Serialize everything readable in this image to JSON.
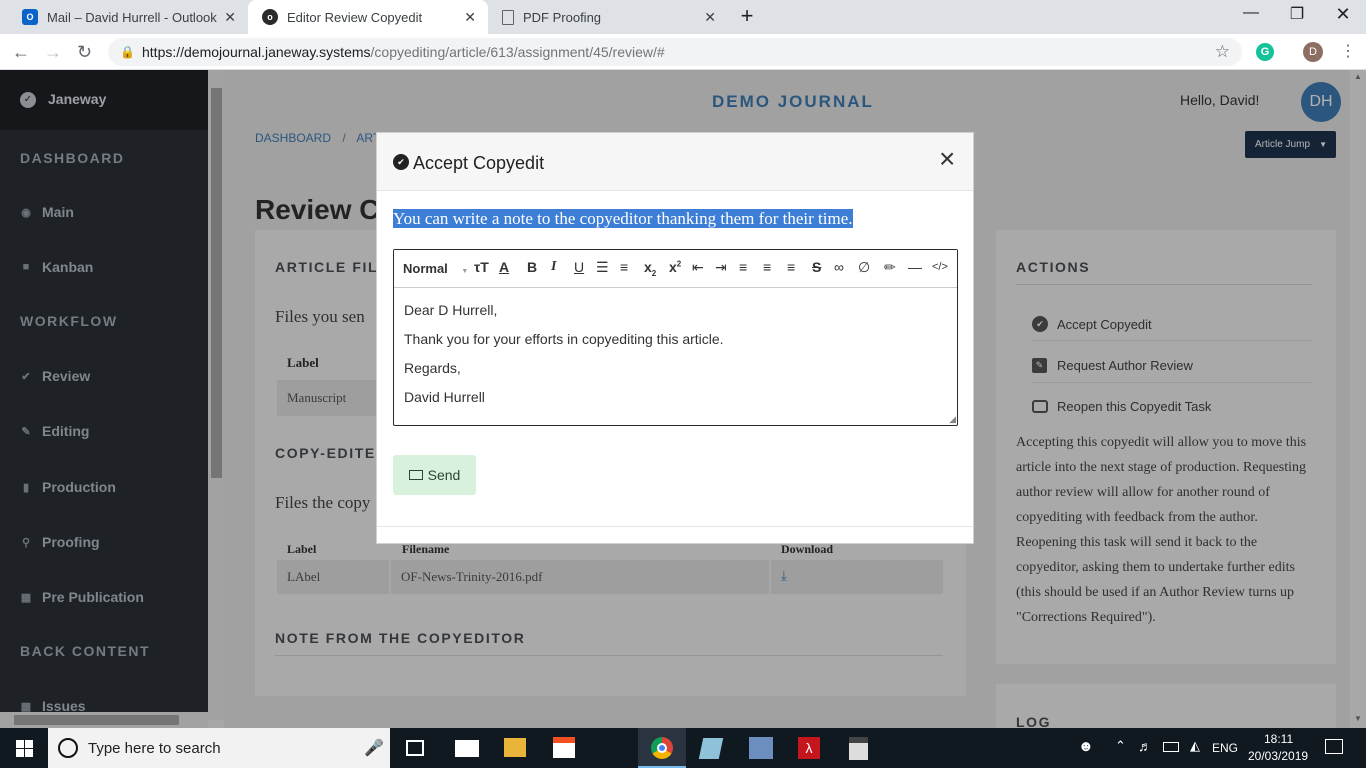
{
  "browser": {
    "tabs": [
      {
        "label": "Mail – David Hurrell - Outlook",
        "icon": "outlook-icon",
        "active": false
      },
      {
        "label": "Editor Review Copyedit",
        "icon": "janeway-icon",
        "active": true
      },
      {
        "label": "PDF Proofing",
        "icon": "document-icon",
        "active": false
      }
    ],
    "new_tab": "+",
    "url_host": "https://demojournal.janeway.systems",
    "url_path": "/copyediting/article/613/assignment/45/review/#",
    "profile_initial": "D"
  },
  "sidebar": {
    "brand": "Janeway",
    "sections": {
      "dashboard": "DASHBOARD",
      "workflow": "WORKFLOW",
      "back_content": "BACK CONTENT"
    },
    "items": {
      "main": "Main",
      "kanban": "Kanban",
      "review": "Review",
      "editing": "Editing",
      "production": "Production",
      "proofing": "Proofing",
      "pre_publication": "Pre Publication",
      "issues": "Issues"
    }
  },
  "header": {
    "journal": "DEMO JOURNAL",
    "greeting": "Hello, David!",
    "avatar": "DH",
    "article_jump": "Article Jump"
  },
  "breadcrumb": {
    "dashboard": "DASHBOARD",
    "sep": "/",
    "next": "ART"
  },
  "page": {
    "title": "Review C",
    "article_files": {
      "heading": "ARTICLE FIL",
      "desc": "Files you sen",
      "col_label": "Label",
      "row_label": "Manuscript"
    },
    "copyedited": {
      "heading": "COPY-EDITE",
      "desc": "Files the copy",
      "col_label": "Label",
      "col_filename": "Filename",
      "col_download": "Download",
      "row_label": "LAbel",
      "row_filename": "OF-News-Trinity-2016.pdf"
    },
    "note_heading": "NOTE FROM THE COPYEDITOR"
  },
  "actions": {
    "heading": "ACTIONS",
    "accept": "Accept Copyedit",
    "request": "Request Author Review",
    "reopen": "Reopen this Copyedit Task",
    "help": "Accepting this copyedit will allow you to move this article into the next stage of production. Requesting author review will allow for another round of copyediting with feedback from the author. Reopening this task will send it back to the copyeditor, asking them to undertake further edits (this should be used if an Author Review turns up \"Corrections Required\").",
    "log_heading": "LOG"
  },
  "modal": {
    "title": "Accept Copyedit",
    "close": "×",
    "instruction": "You can write a note to the copyeditor thanking them for their time.",
    "format_select": "Normal",
    "body_lines": [
      "Dear D Hurrell,",
      "Thank you for your efforts in copyediting this article.",
      "Regards,",
      "David Hurrell"
    ],
    "send_label": "Send"
  },
  "taskbar": {
    "search_placeholder": "Type here to search",
    "language": "ENG",
    "time": "18:11",
    "date": "20/03/2019"
  },
  "colors": {
    "sidebar": "#2b3037",
    "journal_title": "#3e7bb5",
    "avatar_bg": "#3e7bb5",
    "selection": "#3d7fd6",
    "send_bg": "#d7f1dd",
    "article_jump_bg": "#1f3350"
  }
}
